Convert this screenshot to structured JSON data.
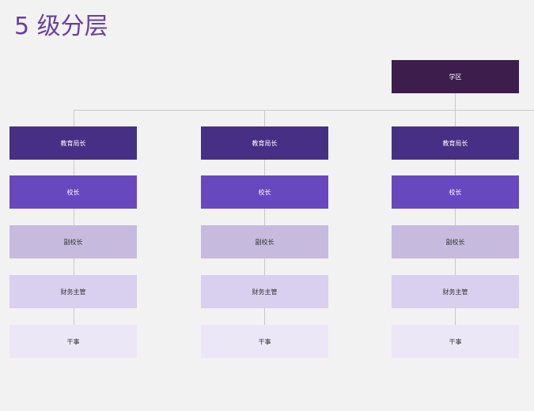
{
  "title": "5 级分层",
  "root": {
    "label": "学区"
  },
  "columns": [
    {
      "levels": [
        "教育局长",
        "校长",
        "副校长",
        "财务主管",
        "干事"
      ]
    },
    {
      "levels": [
        "教育局长",
        "校长",
        "副校长",
        "财务主管",
        "干事"
      ]
    },
    {
      "levels": [
        "教育局长",
        "校长",
        "副校长",
        "财务主管",
        "干事"
      ]
    }
  ],
  "colors": {
    "root": "#3c1d4c",
    "level1": "#472f85",
    "level2": "#6848bf",
    "level3": "#c6badf",
    "level4": "#d9cfee",
    "level5": "#ece7f6",
    "connector": "#c8c8c8",
    "title": "#6a3fa0"
  }
}
